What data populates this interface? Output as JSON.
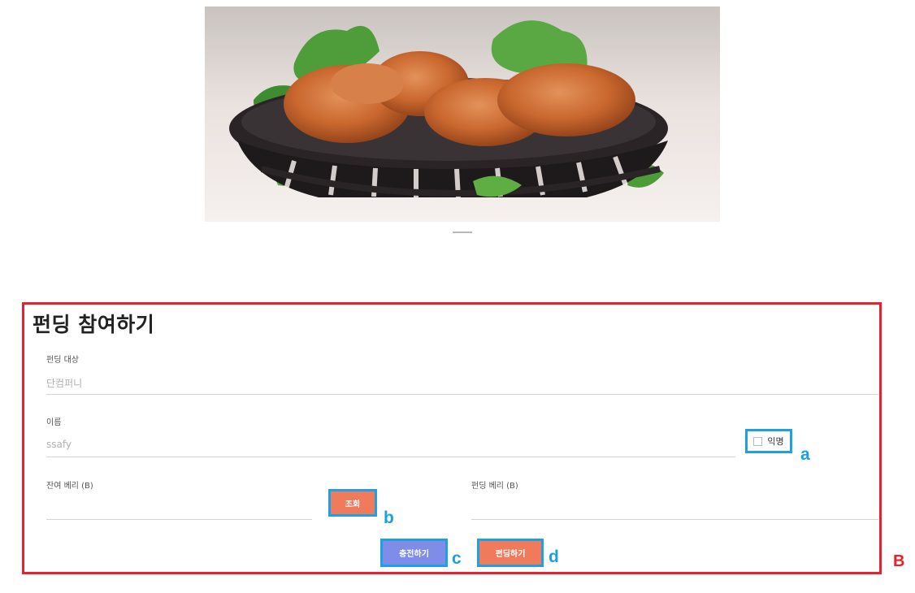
{
  "hero": {
    "image": "fried-chicken-basket"
  },
  "form": {
    "title": "펀딩 참여하기",
    "target_label": "펀딩 대상",
    "target_value": "단컴퍼니",
    "name_label": "이름",
    "name_placeholder": "ssafy",
    "anonymous_label": "익명",
    "balance_label": "잔여 베리 (B)",
    "lookup_button": "조회",
    "funding_amount_label": "펀딩 베리 (B)",
    "charge_button": "충전하기",
    "fund_button": "펀딩하기"
  },
  "annotations": {
    "a": "a",
    "b": "b",
    "c": "c",
    "d": "d",
    "B": "B"
  },
  "colors": {
    "outline_red": "#e8212f",
    "annotation_blue": "#1fa0e0",
    "button_salmon": "#f07a5c",
    "button_purple": "#7f8ce8"
  }
}
